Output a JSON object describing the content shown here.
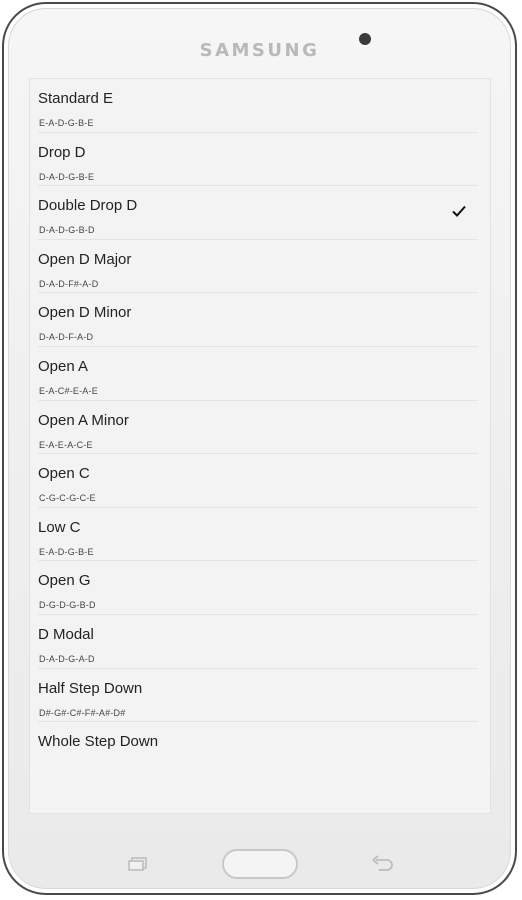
{
  "device": {
    "brand": "SAMSUNG"
  },
  "tunings": [
    {
      "name": "Standard E",
      "notes": "E-A-D-G-B-E",
      "selected": false
    },
    {
      "name": "Drop D",
      "notes": "D-A-D-G-B-E",
      "selected": false
    },
    {
      "name": "Double Drop D",
      "notes": "D-A-D-G-B-D",
      "selected": true
    },
    {
      "name": "Open D Major",
      "notes": "D-A-D-F#-A-D",
      "selected": false
    },
    {
      "name": "Open D Minor",
      "notes": "D-A-D-F-A-D",
      "selected": false
    },
    {
      "name": "Open A",
      "notes": "E-A-C#-E-A-E",
      "selected": false
    },
    {
      "name": "Open A Minor",
      "notes": "E-A-E-A-C-E",
      "selected": false
    },
    {
      "name": "Open C",
      "notes": "C-G-C-G-C-E",
      "selected": false
    },
    {
      "name": "Low C",
      "notes": "E-A-D-G-B-E",
      "selected": false
    },
    {
      "name": "Open G",
      "notes": "D-G-D-G-B-D",
      "selected": false
    },
    {
      "name": "D Modal",
      "notes": "D-A-D-G-A-D",
      "selected": false
    },
    {
      "name": "Half Step Down",
      "notes": "D#-G#-C#-F#-A#-D#",
      "selected": false
    },
    {
      "name": "Whole Step Down",
      "notes": "",
      "selected": false
    }
  ],
  "icons": {
    "selected": "checkmark-icon",
    "nav_recent": "recent-apps-icon",
    "nav_home": "home-button",
    "nav_back": "back-icon"
  }
}
